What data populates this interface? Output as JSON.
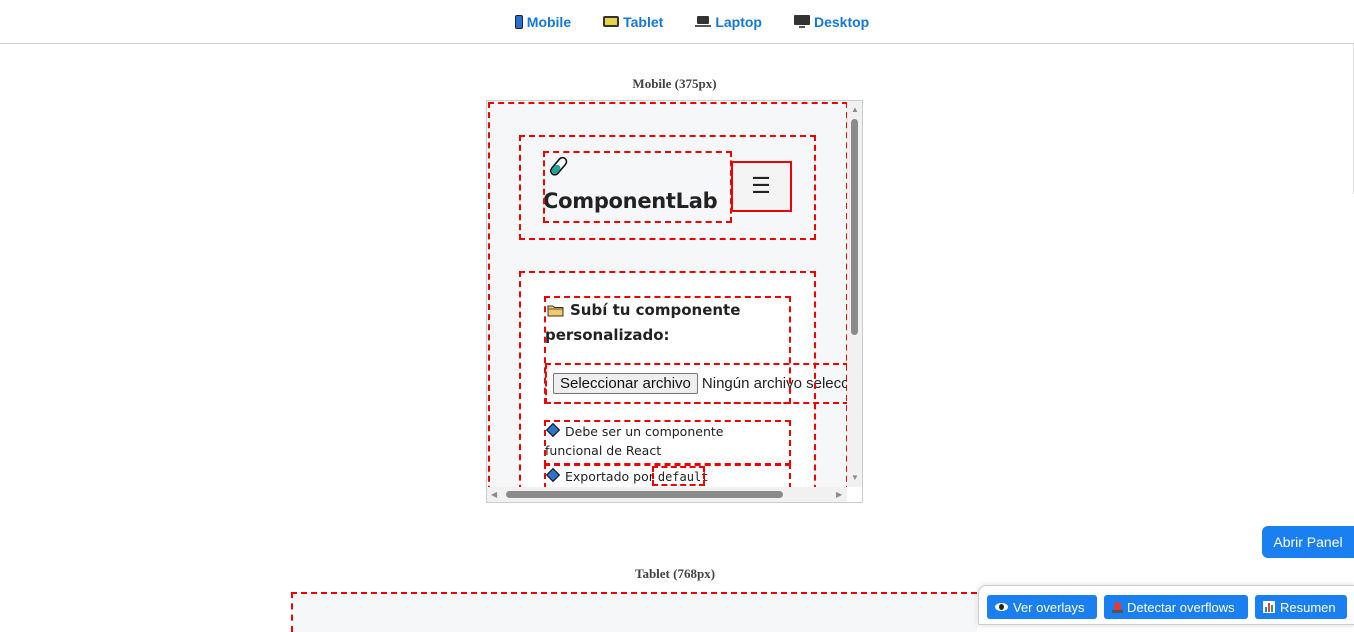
{
  "nav": {
    "items": [
      {
        "label": "Mobile",
        "icon": "mobile-phone-icon"
      },
      {
        "label": "Tablet",
        "icon": "tablet-icon"
      },
      {
        "label": "Laptop",
        "icon": "laptop-icon"
      },
      {
        "label": "Desktop",
        "icon": "desktop-icon"
      }
    ]
  },
  "frames": {
    "mobile_label": "Mobile (375px)",
    "tablet_label": "Tablet (768px)"
  },
  "preview": {
    "brand": "ComponentLab",
    "brand_icon": "test-tube-icon",
    "menu_glyph": "☰",
    "upload_title": "Subí tu componente personalizado:",
    "folder_icon": "folder-icon",
    "file_button": "Seleccionar archivo",
    "file_status": "Ningún archivo seleccionado",
    "requirements": [
      {
        "text": "Debe ser un componente funcional de React"
      },
      {
        "text": "Exportado por ",
        "code": "default"
      }
    ]
  },
  "panel": {
    "open_button": "Abrir Panel",
    "overlays_button": "Ver overlays",
    "overflows_button": "Detectar overflows",
    "summary_button": "Resumen"
  },
  "colors": {
    "accent": "#1a7ff0",
    "nav_link": "#1677d6",
    "overlay_outline": "#e00000"
  }
}
